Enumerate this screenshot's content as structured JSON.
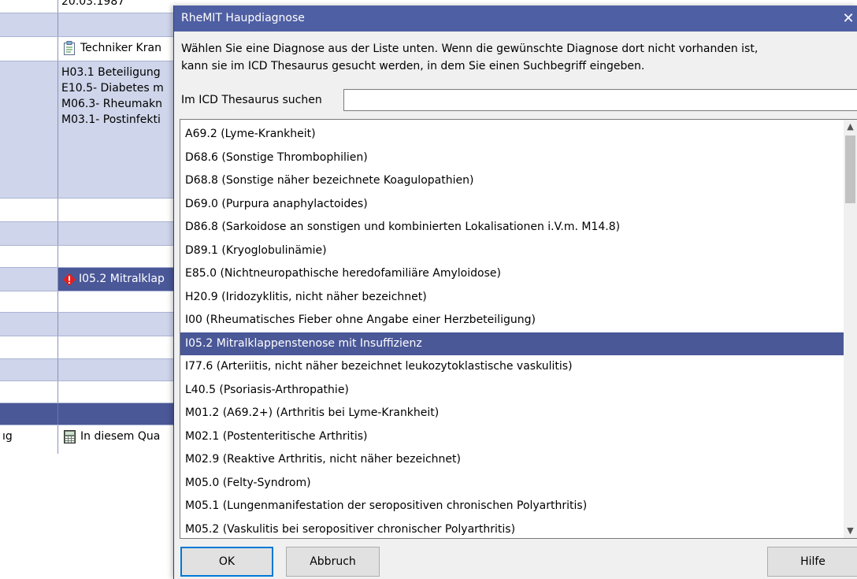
{
  "background": {
    "date": "20.03.1987",
    "insurance": "Techniker Kran",
    "diagnoses": [
      "H03.1 Beteiligung",
      "E10.5- Diabetes m",
      "M06.3- Rheumakn",
      "M03.1- Postinfekti"
    ],
    "warning_diagnosis": "I05.2 Mitralklap",
    "left_fragment": "ıg",
    "quarter_text": "In diesem Qua"
  },
  "dialog": {
    "title": "RheMIT Haupdiagnose",
    "close": "✕",
    "instruction_line1": "Wählen Sie eine Diagnose aus der Liste unten. Wenn die gewünschte Diagnose dort nicht vorhanden ist,",
    "instruction_line2": "kann sie im ICD Thesaurus gesucht werden, in dem Sie einen Suchbegriff eingeben.",
    "search_label": "Im ICD Thesaurus suchen",
    "search_value": "",
    "items": [
      "A69.2 (Lyme-Krankheit)",
      "D68.6 (Sonstige Thrombophilien)",
      "D68.8 (Sonstige näher bezeichnete Koagulopathien)",
      "D69.0 (Purpura anaphylactoides)",
      "D86.8 (Sarkoidose an sonstigen und kombinierten Lokalisationen i.V.m. M14.8)",
      "D89.1 (Kryoglobulinämie)",
      "E85.0 (Nichtneuropathische heredofamiliäre Amyloidose)",
      "H20.9 (Iridozyklitis, nicht näher bezeichnet)",
      "I00 (Rheumatisches Fieber ohne Angabe einer Herzbeteiligung)",
      "I05.2 Mitralklappenstenose mit Insuffizienz",
      "I77.6 (Arteriitis, nicht näher bezeichnet leukozytoklastische vaskulitis)",
      "L40.5 (Psoriasis-Arthropathie)",
      "M01.2 (A69.2+) (Arthritis bei Lyme-Krankheit)",
      "M02.1 (Postenteritische Arthritis)",
      "M02.9 (Reaktive Arthritis, nicht näher bezeichnet)",
      "M05.0 (Felty-Syndrom)",
      "M05.1 (Lungenmanifestation der seropositiven chronischen Polyarthritis)",
      "M05.2 (Vaskulitis bei seropositiver chronischer Polyarthritis)"
    ],
    "selected_index": 9,
    "ok_label": "OK",
    "cancel_label": "Abbruch",
    "help_label": "Hilfe"
  },
  "colors": {
    "titlebar": "#4f5fa3",
    "selection": "#4a5898",
    "row_shade": "#cfd5ea"
  }
}
